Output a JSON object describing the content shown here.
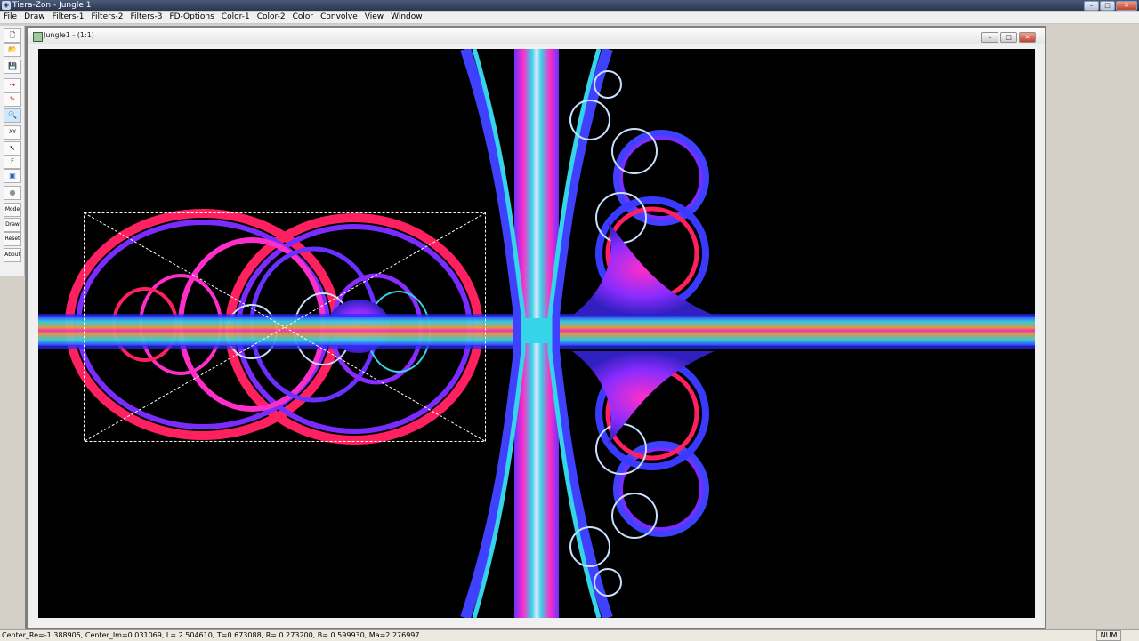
{
  "window": {
    "title": "Tiera-Zon - Jungle 1",
    "app_icon": "fractal-app-icon",
    "controls": {
      "minimize": "–",
      "maximize": "□",
      "close": "✕"
    }
  },
  "menu": [
    "File",
    "Draw",
    "Filters-1",
    "Filters-2",
    "Filters-3",
    "FD-Options",
    "Color-1",
    "Color-2",
    "Color",
    "Convolve",
    "View",
    "Window"
  ],
  "toolbar": {
    "new": "🗋",
    "open": "📂",
    "save": "💾",
    "arrow": "⇢",
    "paint": "✎",
    "zoom": "🔍",
    "xy": "XY",
    "pointer": "↖",
    "f": "F",
    "frame": "▣",
    "dot": "●",
    "mode": "Mode",
    "draw": "Draw",
    "reset": "Reset",
    "about": "About"
  },
  "child_window": {
    "title": "Jungle1 - (1:1)",
    "controls": {
      "minimize": "–",
      "maximize": "□",
      "close": "✕"
    }
  },
  "canvas": {
    "description_icon": "fractal-image",
    "colors": {
      "background": "#000000",
      "magenta": "#ff2ec8",
      "violet": "#7a2cff",
      "blue": "#3a3aff",
      "cyan": "#35d4e8",
      "orange": "#e8a040",
      "red": "#ff2060"
    }
  },
  "status": {
    "text": "Center_Re=-1.388905, Center_Im=0.031069, L= 2.504610, T=0.673088, R= 0.273200, B= 0.599930, Ma=2.276997",
    "num": "NUM"
  }
}
